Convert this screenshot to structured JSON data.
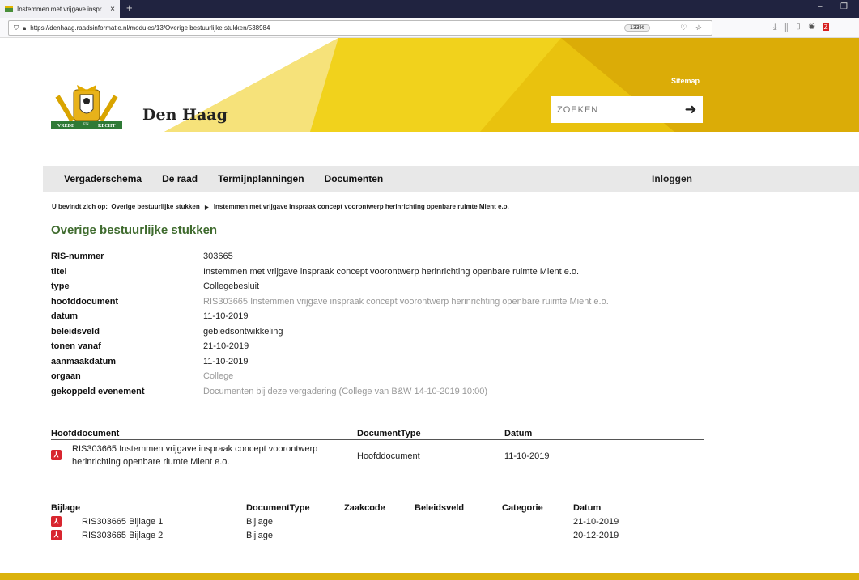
{
  "browser": {
    "tab_title": "Instemmen met vrijgave inspr",
    "tab_close": "×",
    "new_tab": "+",
    "url": "https://denhaag.raadsinformatie.nl/modules/13/Overige bestuurlijke stukken/538984",
    "zoom": "133%",
    "page_actions": "··· ♡ ☆",
    "minimize": "–",
    "restore": "❐"
  },
  "header": {
    "site_name": "Den Haag",
    "motto_left": "VREDE",
    "motto_mid": "EN",
    "motto_right": "RECHT",
    "sitemap": "Sitemap",
    "search_placeholder": "ZOEKEN",
    "search_go": "➜"
  },
  "nav": {
    "items": [
      "Vergaderschema",
      "De raad",
      "Termijnplanningen",
      "Documenten"
    ],
    "login": "Inloggen"
  },
  "breadcrumb": {
    "prefix": "U bevindt zich op:",
    "level1": "Overige bestuurlijke stukken",
    "separator": "▶",
    "current": "Instemmen met vrijgave inspraak concept voorontwerp herinrichting openbare ruimte Mient e.o."
  },
  "page_title": "Overige bestuurlijke stukken",
  "details": [
    {
      "label": "RIS-nummer",
      "value": "303665"
    },
    {
      "label": "titel",
      "value": "Instemmen met vrijgave inspraak concept voorontwerp herinrichting openbare ruimte Mient e.o."
    },
    {
      "label": "type",
      "value": "Collegebesluit"
    },
    {
      "label": "hoofddocument",
      "value": "RIS303665 Instemmen vrijgave inspraak concept voorontwerp herinrichting openbare ruimte Mient e.o."
    },
    {
      "label": "datum",
      "value": "11-10-2019"
    },
    {
      "label": "beleidsveld",
      "value": "gebiedsontwikkeling"
    },
    {
      "label": "tonen vanaf",
      "value": "21-10-2019"
    },
    {
      "label": "aanmaakdatum",
      "value": "11-10-2019"
    },
    {
      "label": "orgaan",
      "value": "College"
    },
    {
      "label": "gekoppeld evenement",
      "value": "Documenten bij deze vergadering (College van B&W 14-10-2019 10:00)"
    }
  ],
  "hoofd_table": {
    "headers": [
      "Hoofddocument",
      "DocumentType",
      "Datum"
    ],
    "rows": [
      {
        "name_line1": "RIS303665 Instemmen vrijgave inspraak concept voorontwerp",
        "name_line2": "herinrichting openbare riumte Mient e.o.",
        "type": "Hoofddocument",
        "date": "11-10-2019"
      }
    ]
  },
  "bijlage_table": {
    "headers": [
      "Bijlage",
      "DocumentType",
      "Zaakcode",
      "Beleidsveld",
      "Categorie",
      "Datum"
    ],
    "rows": [
      {
        "name": "RIS303665 Bijlage 1",
        "type": "Bijlage",
        "date": "21-10-2019"
      },
      {
        "name": "RIS303665 Bijlage 2",
        "type": "Bijlage",
        "date": "20-12-2019"
      }
    ]
  },
  "colors": {
    "accent": "#dbb20c",
    "title_green": "#3f6b2e",
    "pdf_red": "#d8262f"
  },
  "icons": {
    "pdf": "pdf-icon",
    "search_arrow": "arrow-right-icon",
    "lock": "lock-icon",
    "shield": "shield-icon"
  }
}
